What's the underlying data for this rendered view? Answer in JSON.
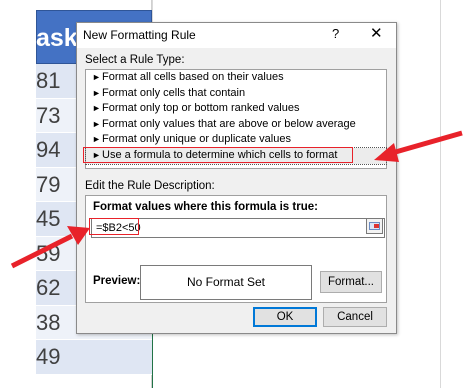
{
  "sheet": {
    "header_text": "asks",
    "rows": [
      "81",
      "73",
      "94",
      "79",
      "45",
      "59",
      "62",
      "38",
      "49"
    ]
  },
  "dialog": {
    "title": "New Formatting Rule",
    "help_label": "?",
    "close_label": "✕",
    "select_rule_type_label": "Select a Rule Type:",
    "rule_types": [
      "Format all cells based on their values",
      "Format only cells that contain",
      "Format only top or bottom ranked values",
      "Format only values that are above or below average",
      "Format only unique or duplicate values",
      "Use a formula to determine which cells to format"
    ],
    "selected_rule_index": 5,
    "edit_description_label": "Edit the Rule Description:",
    "formula_label": "Format values where this formula is true:",
    "formula_value": "=$B2<50",
    "preview_label": "Preview:",
    "preview_text": "No Format Set",
    "format_button": "Format...",
    "ok_button": "OK",
    "cancel_button": "Cancel"
  },
  "colors": {
    "header_fill": "#4472c4",
    "annotation_red": "#e8222a",
    "row_fill": "#dfe6f3"
  }
}
